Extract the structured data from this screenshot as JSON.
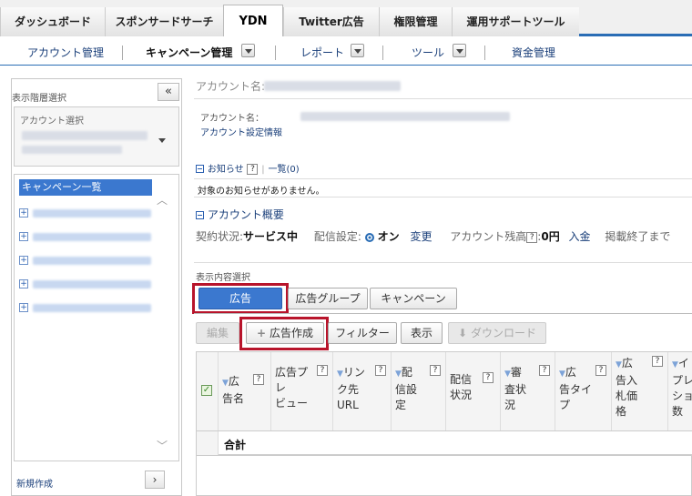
{
  "top_tabs": [
    "ダッシュボード",
    "スポンサードサーチ",
    "YDN",
    "Twitter広告",
    "権限管理",
    "運用サポートツール"
  ],
  "sub_nav": {
    "account_mgmt": "アカウント管理",
    "campaign_mgmt": "キャンペーン管理",
    "report": "レポート",
    "tools": "ツール",
    "funds": "資金管理"
  },
  "left_panel": {
    "title": "表示階層選択",
    "collapse": "«",
    "account_select_label": "アカウント選択",
    "tree_header": "キャンペーン一覧",
    "tree_items_count_plus": "+",
    "new_create": "新規作成",
    "next": "›"
  },
  "main": {
    "account_name_label": "アカウント名:",
    "account_name_small": "アカウント名：",
    "account_settings_link": "アカウント設定情報",
    "notice_label": "お知らせ",
    "notice_list_link": "一覧(0)",
    "notice_empty": "対象のお知らせがありません。",
    "overview_label": "アカウント概要",
    "contract_status_label": "契約状況:",
    "contract_status_value": "サービス中",
    "delivery_label": "配信設定:",
    "delivery_value": "オン",
    "delivery_change": "変更",
    "balance_label": "アカウント残高",
    "balance_value": "0円",
    "deposit_link": "入金",
    "end_notice": "掲載終了まで",
    "display_select_label": "表示内容選択",
    "view_tabs": [
      "広告",
      "広告グループ",
      "キャンペーン"
    ],
    "toolbar": {
      "edit": "編集",
      "create_ad": "広告作成",
      "filter": "フィルター",
      "display": "表示",
      "download": "ダウンロード"
    },
    "table_headers": [
      [
        "▼広",
        "告名"
      ],
      [
        "広告プ",
        "レ",
        "ビュー"
      ],
      [
        "▼リン",
        "ク先",
        "URL"
      ],
      [
        "▼配",
        "信設",
        "定"
      ],
      [
        "配信",
        "状況"
      ],
      [
        "▼審",
        "査状",
        "況"
      ],
      [
        "▼広",
        "告タイ",
        "プ"
      ],
      [
        "▼広",
        "告入",
        "札価",
        "格"
      ],
      [
        "▼イ",
        "プレ",
        "ショ",
        "数"
      ]
    ],
    "sum_label": "合計"
  }
}
